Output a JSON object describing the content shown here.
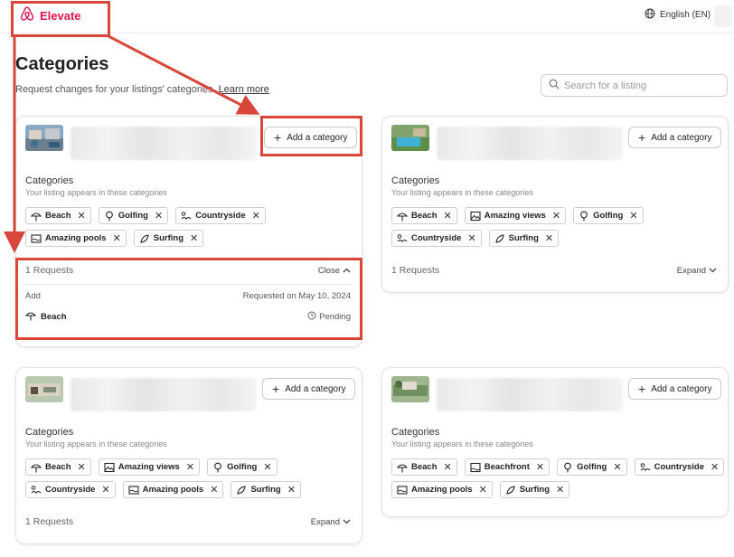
{
  "header": {
    "brand": "Elevate",
    "language": "English (EN)"
  },
  "page": {
    "title": "Categories",
    "subtitle": "Request changes for your listings' categories.",
    "learn_more": "Learn more"
  },
  "search": {
    "placeholder": "Search for a listing"
  },
  "card_labels": {
    "add_category": "Add a category",
    "categories_title": "Categories",
    "categories_subtitle": "Your listing appears in these categories"
  },
  "listings": [
    {
      "chips": [
        "Beach",
        "Golfing",
        "Countryside",
        "Amazing pools",
        "Surfing"
      ],
      "requests_count": "1 Requests",
      "toggle": "Close",
      "request": {
        "type": "Add",
        "date": "Requested on May 10, 2024",
        "category": "Beach",
        "status": "Pending"
      }
    },
    {
      "chips": [
        "Beach",
        "Amazing views",
        "Golfing",
        "Countryside",
        "Surfing"
      ],
      "requests_count": "1 Requests",
      "toggle": "Expand"
    },
    {
      "chips": [
        "Beach",
        "Amazing views",
        "Golfing",
        "Countryside",
        "Amazing pools",
        "Surfing"
      ],
      "requests_count": "1 Requests",
      "toggle": "Expand"
    },
    {
      "chips": [
        "Beach",
        "Beachfront",
        "Golfing",
        "Countryside",
        "Amazing pools",
        "Surfing"
      ]
    }
  ],
  "icons": {
    "Beach": "umbrella-icon",
    "Golfing": "golf-icon",
    "Countryside": "countryside-icon",
    "Amazing pools": "pool-icon",
    "Surfing": "surfboard-icon",
    "Amazing views": "view-icon",
    "Beachfront": "beachfront-icon"
  },
  "colors": {
    "brand": "#e0134f",
    "annotation": "#d9473b"
  }
}
